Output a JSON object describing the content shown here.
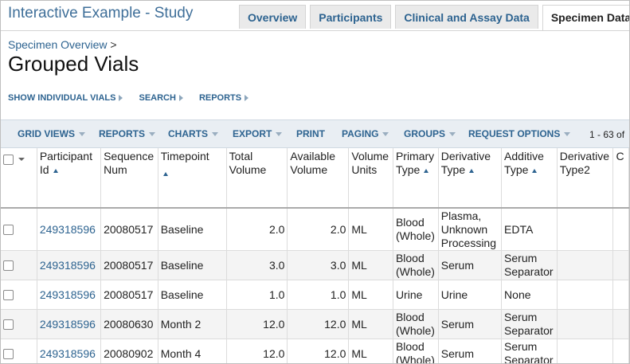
{
  "header": {
    "app_title": "Interactive Example - Study",
    "tabs": [
      {
        "label": "Overview",
        "active": false
      },
      {
        "label": "Participants",
        "active": false
      },
      {
        "label": "Clinical and Assay Data",
        "active": false
      },
      {
        "label": "Specimen Data",
        "active": true
      }
    ]
  },
  "breadcrumb": {
    "link": "Specimen Overview",
    "separator": ">"
  },
  "page_title": "Grouped Vials",
  "links_bar": [
    {
      "label": "SHOW INDIVIDUAL VIALS"
    },
    {
      "label": "SEARCH"
    },
    {
      "label": "REPORTS"
    }
  ],
  "toolbar": {
    "items": [
      {
        "label": "GRID VIEWS",
        "dropdown": true
      },
      {
        "label": "REPORTS",
        "dropdown": true
      },
      {
        "label": "CHARTS",
        "dropdown": true
      },
      {
        "label": "EXPORT",
        "dropdown": true
      },
      {
        "label": "PRINT",
        "dropdown": false
      },
      {
        "label": "PAGING",
        "dropdown": true
      },
      {
        "label": "GROUPS",
        "dropdown": true
      },
      {
        "label": "REQUEST OPTIONS",
        "dropdown": true
      }
    ],
    "paging_count": "1 - 63 of"
  },
  "grid": {
    "columns": [
      {
        "key": "participant",
        "lines": [
          "Participant",
          "Id"
        ],
        "sorted": true
      },
      {
        "key": "sequence",
        "lines": [
          "Sequence",
          "Num"
        ],
        "sorted": false
      },
      {
        "key": "timepoint",
        "lines": [
          "Timepoint"
        ],
        "sorted": true
      },
      {
        "key": "total",
        "lines": [
          "Total",
          "Volume"
        ],
        "sorted": false
      },
      {
        "key": "available",
        "lines": [
          "Available",
          "Volume"
        ],
        "sorted": false
      },
      {
        "key": "units",
        "lines": [
          "Volume",
          "Units"
        ],
        "sorted": false
      },
      {
        "key": "primary",
        "lines": [
          "Primary",
          "Type"
        ],
        "sorted": true
      },
      {
        "key": "derivative",
        "lines": [
          "Derivative",
          "Type"
        ],
        "sorted": true
      },
      {
        "key": "additive",
        "lines": [
          "Additive",
          "Type"
        ],
        "sorted": true
      },
      {
        "key": "derivative2",
        "lines": [
          "Derivative",
          "Type2"
        ],
        "sorted": false
      },
      {
        "key": "cut",
        "lines": [
          "C"
        ],
        "sorted": false
      }
    ],
    "rows": [
      {
        "participant": "249318596",
        "sequence": "20080517",
        "timepoint": "Baseline",
        "total": "2.0",
        "available": "2.0",
        "units": "ML",
        "primary": "Blood (Whole)",
        "derivative": "Plasma, Unknown Processing",
        "additive": "EDTA",
        "derivative2": "",
        "cut": ""
      },
      {
        "participant": "249318596",
        "sequence": "20080517",
        "timepoint": "Baseline",
        "total": "3.0",
        "available": "3.0",
        "units": "ML",
        "primary": "Blood (Whole)",
        "derivative": "Serum",
        "additive": "Serum Separator",
        "derivative2": "",
        "cut": ""
      },
      {
        "participant": "249318596",
        "sequence": "20080517",
        "timepoint": "Baseline",
        "total": "1.0",
        "available": "1.0",
        "units": "ML",
        "primary": "Urine",
        "derivative": "Urine",
        "additive": "None",
        "derivative2": "",
        "cut": ""
      },
      {
        "participant": "249318596",
        "sequence": "20080630",
        "timepoint": "Month 2",
        "total": "12.0",
        "available": "12.0",
        "units": "ML",
        "primary": "Blood (Whole)",
        "derivative": "Serum",
        "additive": "Serum Separator",
        "derivative2": "",
        "cut": ""
      },
      {
        "participant": "249318596",
        "sequence": "20080902",
        "timepoint": "Month 4",
        "total": "12.0",
        "available": "12.0",
        "units": "ML",
        "primary": "Blood (Whole)",
        "derivative": "Serum",
        "additive": "Serum Separator",
        "derivative2": "",
        "cut": ""
      }
    ]
  }
}
